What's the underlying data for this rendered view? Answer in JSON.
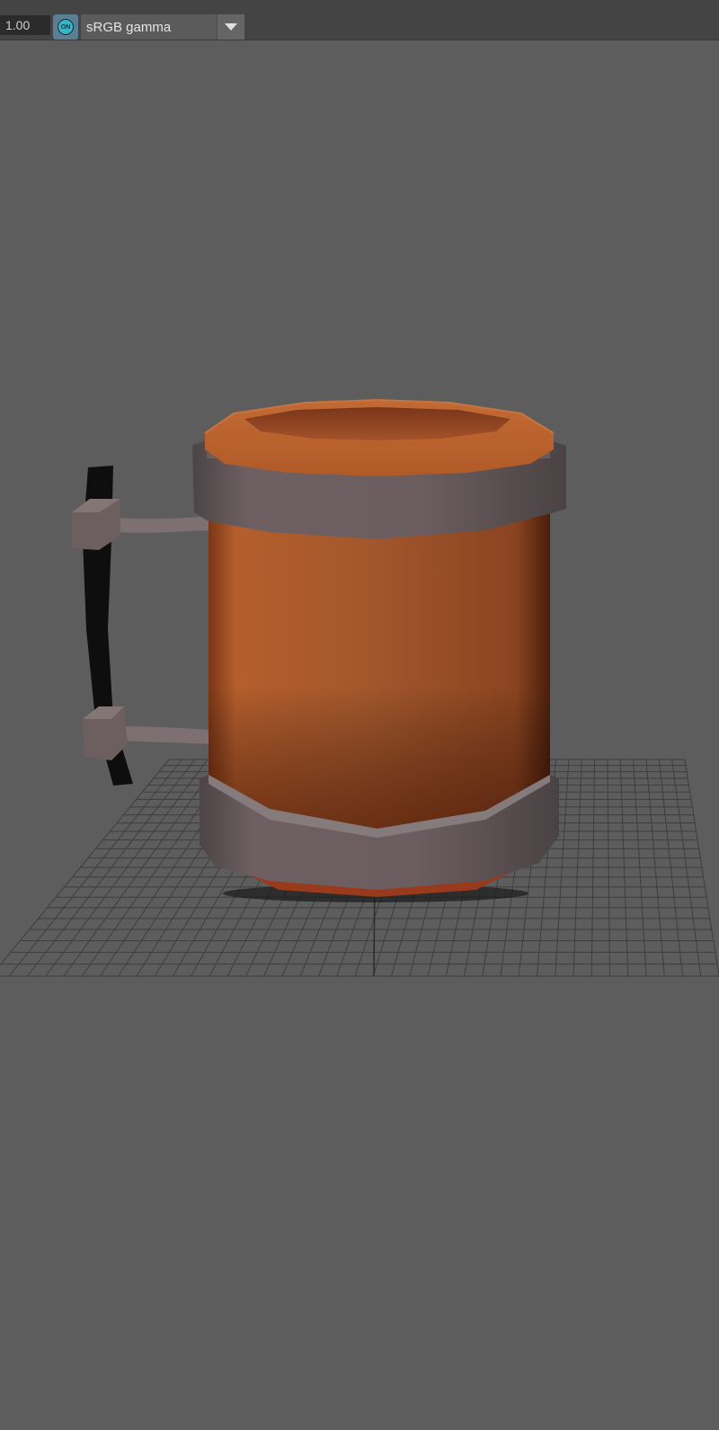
{
  "toolbar": {
    "exposure_value": "1.00",
    "color_management_toggle": "ON",
    "view_transform": "sRGB gamma"
  },
  "viewport": {
    "background_color": "#5d5d5d",
    "grid_visible": true,
    "object": "beer mug",
    "colors": {
      "wood": "#a85a2c",
      "metal_band": "#6e6062",
      "handle": "#111111"
    }
  }
}
